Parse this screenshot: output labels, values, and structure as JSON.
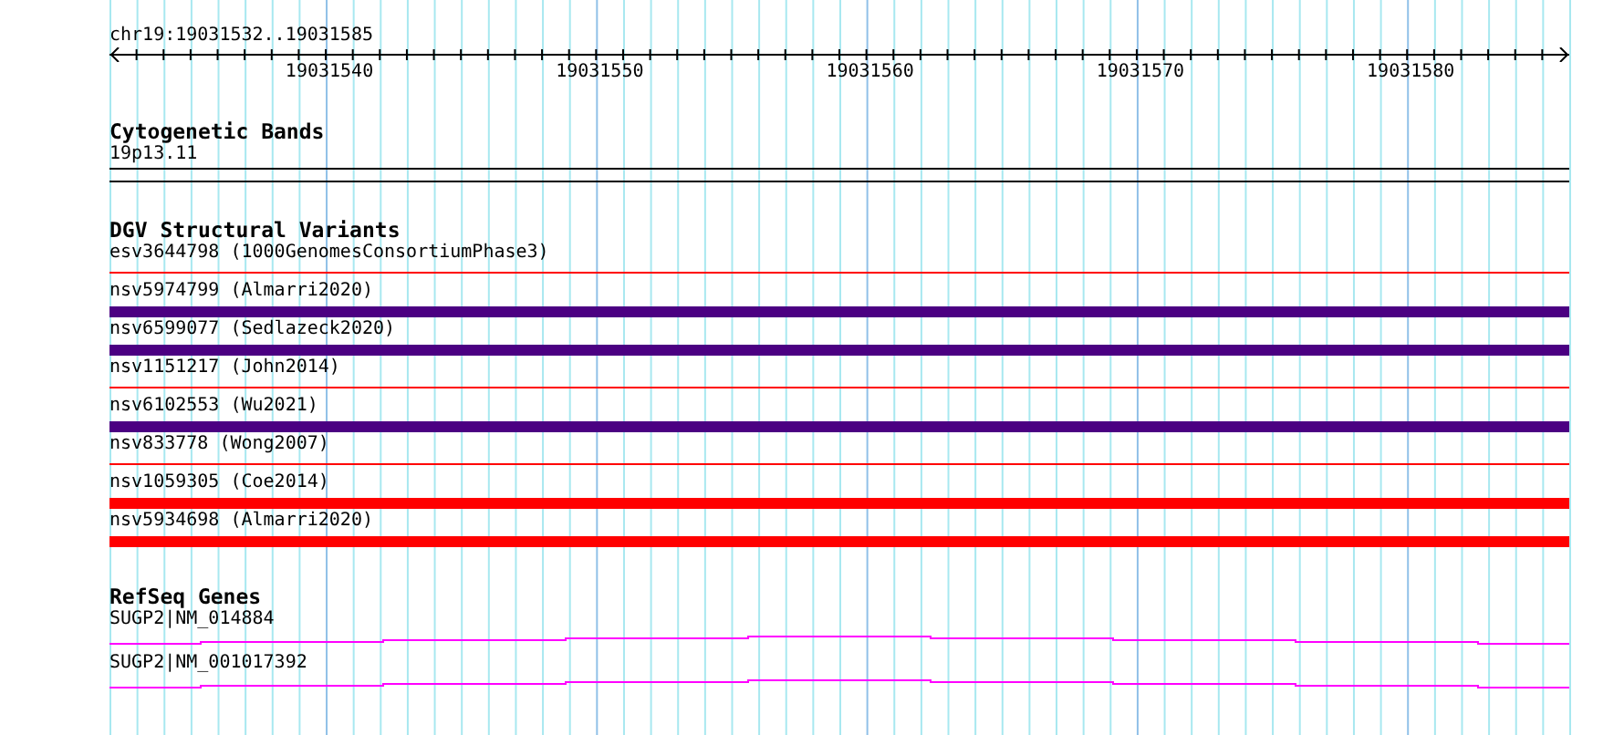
{
  "ruler": {
    "location": "chr19:19031532..19031585",
    "ticks": [
      "19031540",
      "19031550",
      "19031560",
      "19031570",
      "19031580"
    ]
  },
  "tracks": [
    {
      "kind": "bands",
      "title": "Cytogenetic Bands",
      "items": [
        {
          "label": "19p13.11"
        }
      ]
    },
    {
      "kind": "variants",
      "title": "DGV Structural Variants",
      "items": [
        {
          "label": "esv3644798 (1000GenomesConsortiumPhase3)",
          "kind": "thin",
          "color": "#ff0000"
        },
        {
          "label": "nsv5974799 (Almarri2020)",
          "kind": "thick",
          "color": "#4b0082"
        },
        {
          "label": "nsv6599077 (Sedlazeck2020)",
          "kind": "thick",
          "color": "#4b0082"
        },
        {
          "label": "nsv1151217 (John2014)",
          "kind": "thin",
          "color": "#ff0000"
        },
        {
          "label": "nsv6102553 (Wu2021)",
          "kind": "thick",
          "color": "#4b0082"
        },
        {
          "label": "nsv833778 (Wong2007)",
          "kind": "thin",
          "color": "#ff0000"
        },
        {
          "label": "nsv1059305 (Coe2014)",
          "kind": "thick",
          "color": "#ff0000"
        },
        {
          "label": "nsv5934698 (Almarri2020)",
          "kind": "thick",
          "color": "#ff0000"
        }
      ]
    },
    {
      "kind": "genes",
      "title": "RefSeq Genes",
      "items": [
        {
          "label": "SUGP2|NM_014884"
        },
        {
          "label": "SUGP2|NM_001017392"
        }
      ]
    }
  ]
}
